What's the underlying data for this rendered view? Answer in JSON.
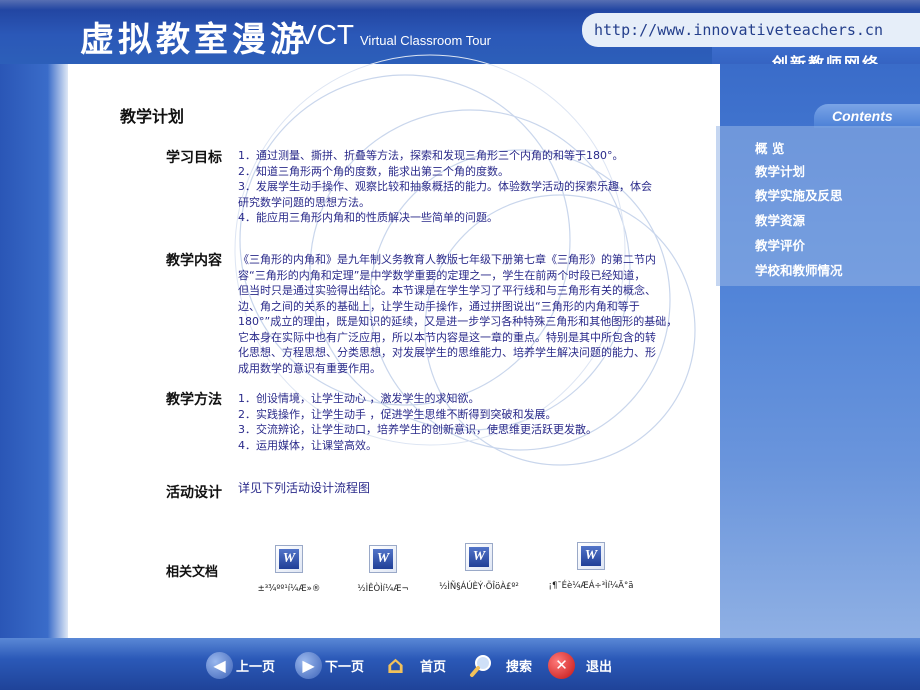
{
  "header": {
    "title_cn": "虚拟教室漫游",
    "title_vct": "VCT",
    "title_sub": "Virtual Classroom Tour",
    "url": "http://www.innovativeteachers.cn",
    "network": "创新教师网络"
  },
  "page_title": "教学计划",
  "sections": {
    "goals": {
      "label": "学习目标",
      "lines": [
        "1．通过测量、撕拼、折叠等方法，探索和发现三角形三个内角的和等于180°。",
        "2．知道三角形两个角的度数，能求出第三个角的度数。",
        "3．发展学生动手操作、观察比较和抽象概括的能力。体验数学活动的探索乐趣，体会",
        "研究数学问题的思想方法。",
        "4．能应用三角形内角和的性质解决一些简单的问题。"
      ]
    },
    "content": {
      "label": "教学内容",
      "lines": [
        "《三角形的内角和》是九年制义务教育人教版七年级下册第七章《三角形》的第二节内",
        "容“三角形的内角和定理”是中学数学重要的定理之一，学生在前两个时段已经知道，",
        "但当时只是通过实验得出结论。本节课是在学生学习了平行线和与三角形有关的概念、",
        "边、角之间的关系的基础上，让学生动手操作，通过拼图说出“三角形的内角和等于",
        "180°”成立的理由，既是知识的延续，又是进一步学习各种特殊三角形和其他图形的基础，",
        "它本身在实际中也有广泛应用，所以本节内容是这一章的重点。特别是其中所包含的转",
        "化思想、方程思想、分类思想，对发展学生的思维能力、培养学生解决问题的能力、形",
        "成用数学的意识有重要作用。"
      ]
    },
    "methods": {
      "label": "教学方法",
      "lines": [
        "1．创设情境，让学生动心 ，激发学生的求知欲。",
        "2．实践操作，让学生动手 ，促进学生思维不断得到突破和发展。",
        "3．交流辨论，让学生动口，培养学生的创新意识，使思维更活跃更发散。",
        "4．运用媒体，让课堂高效。"
      ]
    },
    "activity": {
      "label": "活动设计",
      "text": "详见下列活动设计流程图"
    },
    "docs": {
      "label": "相关文档",
      "items": [
        {
          "icon": "word-document-icon",
          "letter": "W",
          "caption": "±³¾ºº¹í¼Æ»®"
        },
        {
          "icon": "word-document-icon",
          "letter": "W",
          "caption": "½ÌÊÒÌí¼Æ¬"
        },
        {
          "icon": "word-document-icon",
          "letter": "W",
          "caption": "½ÌÑ§ÁÚÈÝ·ÖÎöÀ£º²"
        },
        {
          "icon": "word-document-icon",
          "letter": "W",
          "caption": "¡¶¯Éè¼ÆÁ÷³Ìí¼Ä°ã"
        }
      ]
    }
  },
  "sidebar": {
    "contents_label": "Contents",
    "items": [
      "概  览",
      "教学计划",
      "教学实施及反思",
      "教学资源",
      "教学评价",
      "学校和教师情况"
    ]
  },
  "footer": {
    "prev": "上一页",
    "next": "下一页",
    "home": "首页",
    "search": "搜索",
    "exit": "退出"
  }
}
